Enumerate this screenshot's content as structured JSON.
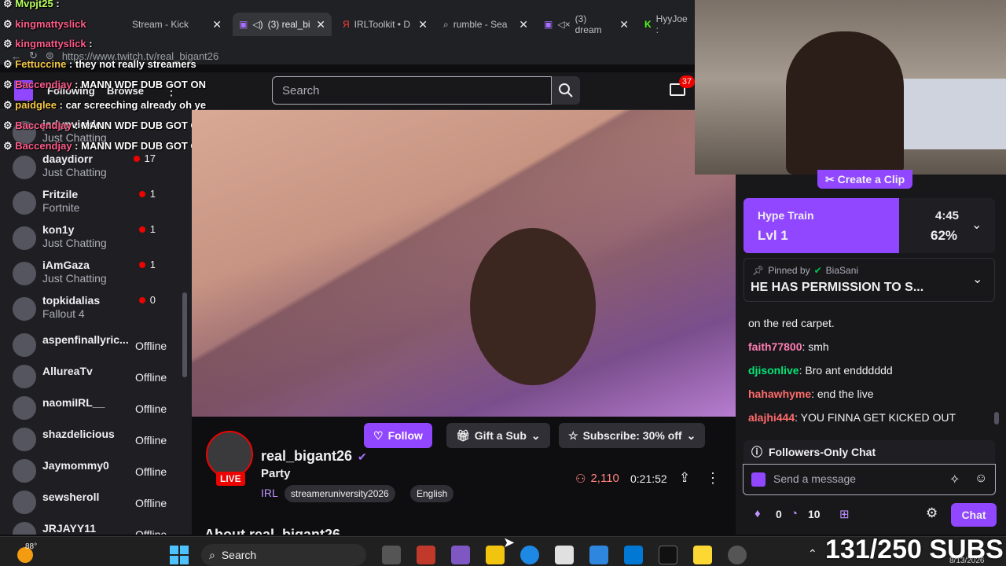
{
  "browser": {
    "tabs": [
      {
        "label": "Stream - Kick"
      },
      {
        "label": "(3) real_bi"
      },
      {
        "label": "IRLToolkit • D"
      },
      {
        "label": "rumble - Sea"
      },
      {
        "label": "(3) dream"
      },
      {
        "label": "HyyJoe :"
      }
    ],
    "url": "https://www.twitch.tv/real_bigant26"
  },
  "overlay_chat": [
    {
      "user": "Mvpjt25",
      "msg": ":"
    },
    {
      "user": "kingmattyslick",
      "msg": ""
    },
    {
      "user": "kingmattyslick",
      "msg": ":"
    },
    {
      "user": "Fettuccine",
      "msg": ": they not really streamers"
    },
    {
      "user": "Baccendjay",
      "msg": ": MANN WDF DUB GOT ON"
    },
    {
      "user": "paidglee",
      "msg": ": car screeching already oh ye"
    },
    {
      "user": "Baccendjay",
      "msg": ": MANN WDF DUB GOT ON"
    },
    {
      "user": "Baccendjay",
      "msg": ": MANN WDF DUB GOT ON"
    }
  ],
  "twitch_nav": {
    "following": "Following",
    "browse": "Browse",
    "search_placeholder": "Search",
    "notif_count": "37"
  },
  "sidebar": {
    "channels": [
      {
        "name": "jadypvickle",
        "game": "Just Chatting",
        "viewers": "",
        "status": "live"
      },
      {
        "name": "daaydiorr",
        "game": "Just Chatting",
        "viewers": "17",
        "status": "live"
      },
      {
        "name": "Fritzile",
        "game": "Fortnite",
        "viewers": "1",
        "status": "live"
      },
      {
        "name": "kon1y",
        "game": "Just Chatting",
        "viewers": "1",
        "status": "live"
      },
      {
        "name": "iAmGaza",
        "game": "Just Chatting",
        "viewers": "1",
        "status": "live"
      },
      {
        "name": "topkidalias",
        "game": "Fallout 4",
        "viewers": "0",
        "status": "live"
      },
      {
        "name": "aspenfinallyric...",
        "game": "",
        "viewers": "Offline",
        "status": "offline"
      },
      {
        "name": "AllureaTv",
        "game": "",
        "viewers": "Offline",
        "status": "offline"
      },
      {
        "name": "naomiIRL__",
        "game": "",
        "viewers": "Offline",
        "status": "offline"
      },
      {
        "name": "shazdelicious",
        "game": "",
        "viewers": "Offline",
        "status": "offline"
      },
      {
        "name": "Jaymommy0",
        "game": "",
        "viewers": "Offline",
        "status": "offline"
      },
      {
        "name": "sewsheroll",
        "game": "",
        "viewers": "Offline",
        "status": "offline"
      },
      {
        "name": "JRJAYY11",
        "game": "",
        "viewers": "Offline",
        "status": "offline"
      }
    ]
  },
  "stream": {
    "channel": "real_bigant26",
    "title": "Party",
    "live_badge": "LIVE",
    "category": "IRL",
    "tags": [
      "streameruniversity2026",
      "English"
    ],
    "viewers": "2,110",
    "uptime": "0:21:52",
    "follow": "Follow",
    "gift": "Gift a Sub",
    "subscribe": "Subscribe: 30% off",
    "about": "About real_bigant26"
  },
  "chat": {
    "create_clip": "Create a Clip",
    "hype_train": {
      "label": "Hype Train",
      "level": "Lvl 1",
      "time": "4:45",
      "percent": "62%",
      "progress": 0.62
    },
    "pinned": {
      "by_label": "Pinned by",
      "by_user": "BiaSani",
      "text": "HE HAS PERMISSION TO S..."
    },
    "messages": [
      {
        "user": "",
        "text": "on the red carpet.",
        "color": "#efeff1"
      },
      {
        "user": "faith77800",
        "text": ": smh",
        "color": "#ff7eb3"
      },
      {
        "user": "djisonlive",
        "text": ": Bro ant endddddd",
        "color": "#00e676"
      },
      {
        "user": "hahawhyme",
        "text": ": end the live",
        "color": "#ff6b6b"
      },
      {
        "user": "alajhi444",
        "text": ": YOU FINNA GET KICKED OUT",
        "color": "#ff6b6b"
      }
    ],
    "followers_only": "Followers-Only Chat",
    "input_placeholder": "Send a message",
    "points": "0",
    "bits": "10",
    "chat_button": "Chat"
  },
  "taskbar": {
    "weather": "88°",
    "search": "Search",
    "sub_goal": "131/250 SUBS",
    "date": "8/13/2026"
  }
}
